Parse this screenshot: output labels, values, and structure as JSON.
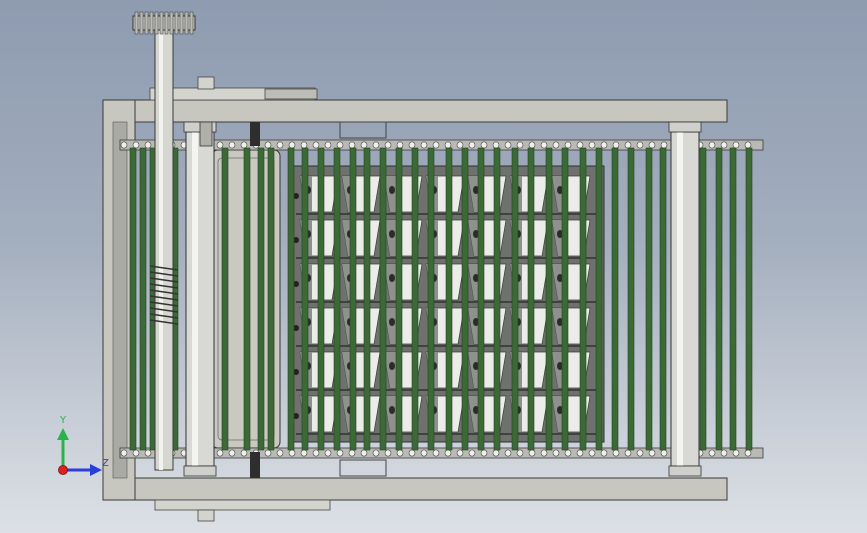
{
  "viewport": {
    "background_top": "#8e9bb0",
    "background_bottom": "#dde1e6",
    "model": "belt-conveyor-assembly",
    "view": "front-orthographic"
  },
  "axis_triad": {
    "labels": {
      "y": "Y",
      "z": "Z"
    },
    "colors": {
      "y": "#2bb24c",
      "z": "#2a3fd8",
      "x": "#e02020"
    }
  },
  "colors": {
    "frame": "#c7c6bf",
    "frame_edge": "#3a3a3a",
    "slat": "#3b6a37",
    "slat_dark": "#234421",
    "chain": "#b9bab6",
    "roller": "#d8d9d4",
    "bucket_face": "#ececeb",
    "bucket_shadow": "#8f918d"
  }
}
